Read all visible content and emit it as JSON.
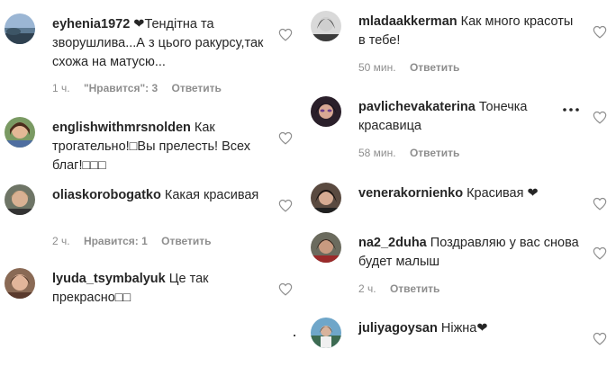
{
  "left_comments": [
    {
      "username": "eyhenia1972",
      "text": "❤Тендітна та зворушлива...А з цього ракурсу,так схожа на матусю...",
      "time": "1 ч.",
      "likes": "\"Нравится\": 3",
      "reply": "Ответить"
    },
    {
      "username": "englishwithmrsnolden",
      "text": "Как трогательно!□Вы прелесть! Всех благ!□□□",
      "time": "",
      "likes": "",
      "reply": ""
    },
    {
      "username": "oliaskorobogatko",
      "text": "Какая красивая",
      "time": "2 ч.",
      "likes": "Нравится: 1",
      "reply": "Ответить"
    },
    {
      "username": "lyuda_tsymbalyuk",
      "text": "Це так прекрасно□□",
      "time": "",
      "likes": "",
      "reply": ""
    }
  ],
  "right_comments": [
    {
      "username": "mladaakkerman",
      "text": "Как много красоты в тебе!",
      "time": "50 мин.",
      "likes": "",
      "reply": "Ответить"
    },
    {
      "username": "pavlichevakaterina",
      "text": "Тонечка красавица",
      "time": "58 мин.",
      "likes": "",
      "reply": "Ответить"
    },
    {
      "username": "venerakornienko",
      "text": "Красивая ❤",
      "time": "",
      "likes": "",
      "reply": ""
    },
    {
      "username": "na2_2duha",
      "text": "Поздравляю у вас снова будет малыш",
      "time": "2 ч.",
      "likes": "",
      "reply": "Ответить"
    },
    {
      "username": "juliyagoysan",
      "text": "Ніжна❤",
      "time": "",
      "likes": "",
      "reply": ""
    }
  ],
  "icons": {
    "like": "heart-outline-icon",
    "options": "more-options-icon"
  },
  "colors": {
    "text": "#262626",
    "meta": "#8e8e8e",
    "background": "#ffffff"
  }
}
